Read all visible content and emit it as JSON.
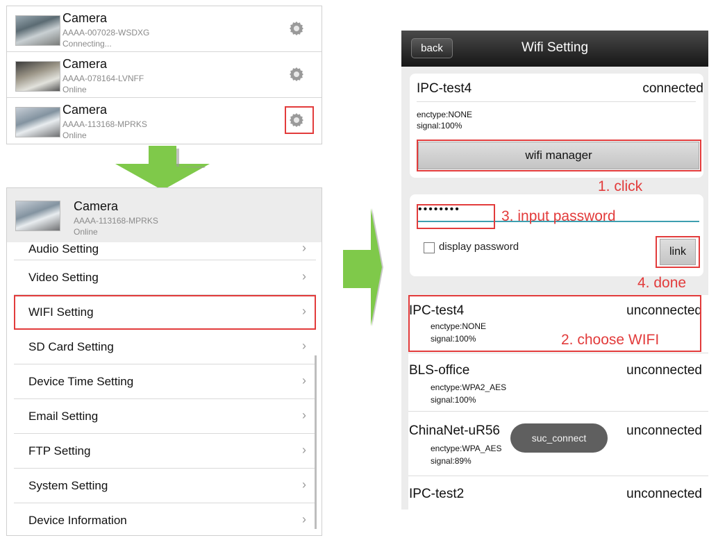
{
  "cameras": [
    {
      "name": "Camera",
      "id": "AAAA-007028-WSDXG",
      "status": "Connecting..."
    },
    {
      "name": "Camera",
      "id": "AAAA-078164-LVNFF",
      "status": "Online"
    },
    {
      "name": "Camera",
      "id": "AAAA-113168-MPRKS",
      "status": "Online"
    }
  ],
  "settings": {
    "camera": {
      "name": "Camera",
      "id": "AAAA-113168-MPRKS",
      "status": "Online"
    },
    "items": [
      "Audio Setting",
      "Video Setting",
      "WIFI Setting",
      "SD Card Setting",
      "Device Time Setting",
      "Email Setting",
      "FTP Setting",
      "System Setting",
      "Device Information"
    ]
  },
  "wifi": {
    "back_label": "back",
    "title": "Wifi Setting",
    "current": {
      "ssid": "IPC-test4",
      "state": "connected",
      "enctype": "enctype:NONE",
      "signal": "signal:100%"
    },
    "manager_label": "wifi manager",
    "password_mask": "••••••••",
    "display_password_label": "display password",
    "link_label": "link",
    "networks": [
      {
        "ssid": "IPC-test4",
        "state": "unconnected",
        "enctype": "enctype:NONE",
        "signal": "signal:100%"
      },
      {
        "ssid": "BLS-office",
        "state": "unconnected",
        "enctype": "enctype:WPA2_AES",
        "signal": "signal:100%"
      },
      {
        "ssid": "ChinaNet-uR56",
        "state": "unconnected",
        "enctype": "enctype:WPA_AES",
        "signal": "signal:89%"
      },
      {
        "ssid": "IPC-test2",
        "state": "unconnected",
        "enctype": "",
        "signal": ""
      }
    ],
    "toast": "suc_connect"
  },
  "annotations": {
    "step1": "1. click",
    "step2": "2. choose WIFI",
    "step3": "3. input password",
    "step4": "4. done"
  },
  "colors": {
    "highlight": "#e23b3b",
    "arrow": "#7fc94a",
    "titlebar": "#1e1e1e"
  }
}
